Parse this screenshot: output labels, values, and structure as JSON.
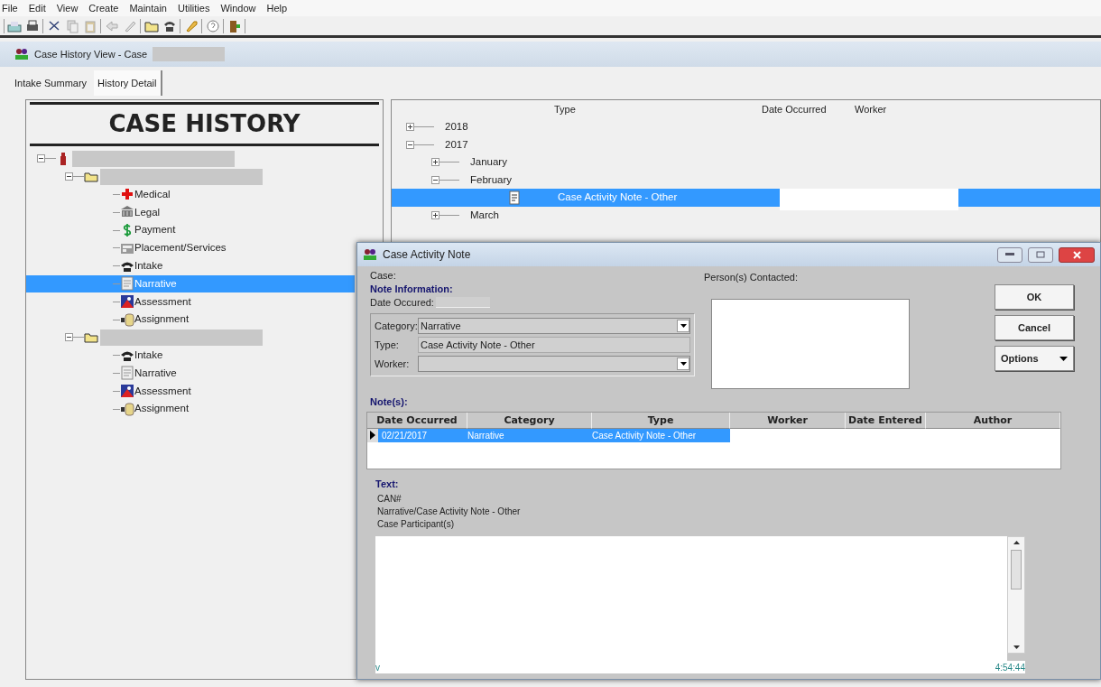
{
  "menu_bar": [
    "File",
    "Edit",
    "View",
    "Create",
    "Maintain",
    "Utilities",
    "Window",
    "Help"
  ],
  "window": {
    "title": "Case History View - Case"
  },
  "tabs": [
    {
      "label": "Intake Summary",
      "selected": false
    },
    {
      "label": "History Detail",
      "selected": true
    }
  ],
  "case_history": {
    "title": "CASE HISTORY",
    "tree": [
      {
        "kind": "person",
        "redacted": true,
        "expanded": true,
        "selected": false,
        "children": [
          {
            "kind": "folder",
            "redacted": true,
            "expanded": true,
            "selected": false,
            "children": [
              {
                "kind": "medical",
                "label": "Medical",
                "selected": false
              },
              {
                "kind": "legal",
                "label": "Legal",
                "selected": false
              },
              {
                "kind": "payment",
                "label": "Payment",
                "selected": false
              },
              {
                "kind": "placement",
                "label": "Placement/Services",
                "selected": false
              },
              {
                "kind": "intake",
                "label": "Intake",
                "selected": false
              },
              {
                "kind": "narrative",
                "label": "Narrative",
                "selected": true
              },
              {
                "kind": "assessment",
                "label": "Assessment",
                "selected": false
              },
              {
                "kind": "assignment",
                "label": "Assignment",
                "selected": false
              }
            ]
          },
          {
            "kind": "folder",
            "redacted": true,
            "expanded": true,
            "selected": false,
            "children": [
              {
                "kind": "intake",
                "label": "Intake",
                "selected": false
              },
              {
                "kind": "narrative",
                "label": "Narrative",
                "selected": false
              },
              {
                "kind": "assessment",
                "label": "Assessment",
                "selected": false
              },
              {
                "kind": "assignment",
                "label": "Assignment",
                "selected": false
              }
            ]
          }
        ]
      }
    ]
  },
  "history_list": {
    "columns": [
      "Type",
      "Date Occurred",
      "Worker"
    ],
    "tree": [
      {
        "label": "2018",
        "expanded": false,
        "selected": false
      },
      {
        "label": "2017",
        "expanded": true,
        "selected": false,
        "children": [
          {
            "label": "January",
            "expanded": false,
            "selected": false
          },
          {
            "label": "February",
            "expanded": true,
            "selected": false,
            "children": [
              {
                "kind": "note",
                "label": "Case Activity Note - Other",
                "selected": true,
                "redacted": true
              }
            ]
          },
          {
            "label": "March",
            "expanded": false,
            "selected": false
          }
        ]
      }
    ]
  },
  "dialog": {
    "title": "Case Activity Note",
    "case_label": "Case:",
    "note_information": "Note Information:",
    "date_occurred_label": "Date Occured:",
    "category": {
      "label": "Category:",
      "value": "Narrative"
    },
    "type": {
      "label": "Type:",
      "value": "Case Activity Note - Other"
    },
    "worker": {
      "label": "Worker:"
    },
    "persons_contacted_label": "Person(s) Contacted:",
    "buttons": [
      {
        "label": "OK",
        "kind": "plain"
      },
      {
        "label": "Cancel",
        "kind": "plain"
      },
      {
        "label": "Options",
        "kind": "menu"
      }
    ],
    "notes": {
      "heading": "Note(s):",
      "columns": [
        "Date Occurred",
        "Category",
        "Type",
        "Worker",
        "Date Entered",
        "Author"
      ],
      "rows": [
        {
          "cells": [
            "02/21/2017",
            "Narrative",
            "Case Activity Note - Other"
          ],
          "selected": true
        }
      ]
    },
    "text": {
      "heading": "Text:",
      "lines": [
        "CAN#",
        "Narrative/Case Activity Note - Other",
        "Case Participant(s)"
      ]
    },
    "status_left": "v",
    "status_time": "4:54:44"
  }
}
